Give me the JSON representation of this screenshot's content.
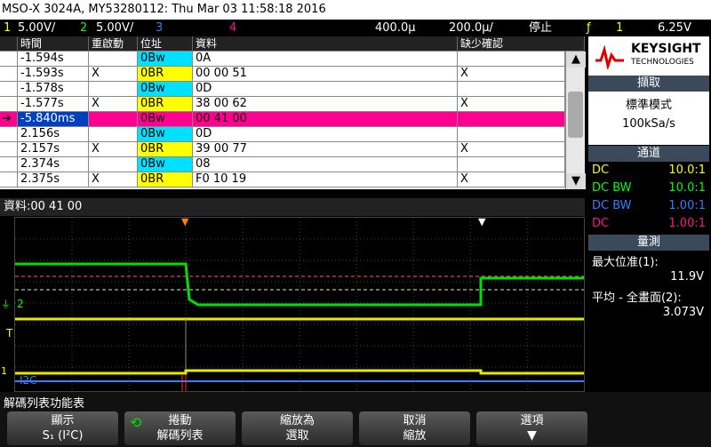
{
  "title": "MSO-X 3024A, MY53280112: Thu Mar 03 11:58:18 2016",
  "status": {
    "ch1_num": "1",
    "ch1_scale": "5.00V/",
    "ch2_num": "2",
    "ch2_scale": "5.00V/",
    "ch3_num": "3",
    "ch4_num": "4",
    "timebase": "400.0µ",
    "delay": "200.0µ/",
    "run_state": "停止",
    "trig_icon": "ƒ",
    "trig_ch": "1",
    "trig_level": "6.25V"
  },
  "table": {
    "headers": [
      "時間",
      "重啟動",
      "位址",
      "資料",
      "缺少確認"
    ],
    "rows": [
      {
        "time": "-1.594s",
        "retry": "",
        "addr": "0Bw",
        "data": "0A",
        "ack": ""
      },
      {
        "time": "-1.593s",
        "retry": "X",
        "addr": "0BR",
        "data": "00 00 51",
        "ack": "X"
      },
      {
        "time": "-1.578s",
        "retry": "",
        "addr": "0Bw",
        "data": "0D",
        "ack": ""
      },
      {
        "time": "-1.577s",
        "retry": "X",
        "addr": "0BR",
        "data": "38 00 62",
        "ack": "X"
      },
      {
        "time": "-5.840ms",
        "retry": "",
        "addr": "0Bw",
        "data": "00 41 00",
        "ack": ""
      },
      {
        "time": "2.156s",
        "retry": "",
        "addr": "0Bw",
        "data": "0D",
        "ack": ""
      },
      {
        "time": "2.157s",
        "retry": "X",
        "addr": "0BR",
        "data": "39 00 77",
        "ack": "X"
      },
      {
        "time": "2.374s",
        "retry": "",
        "addr": "0Bw",
        "data": "08",
        "ack": ""
      },
      {
        "time": "2.375s",
        "retry": "X",
        "addr": "0BR",
        "data": "F0 10 19",
        "ack": "X"
      }
    ],
    "selected_arrow": "➔",
    "scroll_up": "▲",
    "scroll_down": "▼"
  },
  "readout": "資料:00 41 00",
  "scope_labels": {
    "ch2": "2",
    "ch2_ground": "⏚",
    "ch1_marker": "1",
    "trig_marker": "T",
    "i2c_label": "S₁",
    "i2c_suffix": "I2C"
  },
  "side": {
    "brand": "KEYSIGHT",
    "brand_sub": "TECHNOLOGIES",
    "acq_header": "擷取",
    "acq_mode": "標準模式",
    "acq_rate": "100kSa/s",
    "chan_header": "通道",
    "channels": [
      {
        "coupling": "DC",
        "probe": "10.0:1",
        "color": "#ffff00"
      },
      {
        "coupling": "DC BW",
        "probe": "10.0:1",
        "color": "#00ff00"
      },
      {
        "coupling": "DC BW",
        "probe": "1.00:1",
        "color": "#3080ff"
      },
      {
        "coupling": "DC",
        "probe": "1.00:1",
        "color": "#ff1090"
      }
    ],
    "meas_header": "量測",
    "meas1_label": "最大位准(1):",
    "meas1_value": "11.9V",
    "meas2_label": "平均 - 全畫面(2):",
    "meas2_value": "3.073V"
  },
  "softkeys": {
    "title": "解碼列表功能表",
    "k1_line1": "顯示",
    "k1_line2": "S₁ (I²C)",
    "k2_line1": "捲動",
    "k2_line2": "解碼列表",
    "k3_line1": "縮放為",
    "k3_line2": "選取",
    "k4_line1": "取消",
    "k4_line2": "縮放",
    "k5_line1": "選項",
    "k5_icon": "▼"
  },
  "colors": {
    "ch1": "#ffff00",
    "ch2": "#00ff00",
    "ch3": "#3080ff",
    "ch4": "#ff1090",
    "addr_write": "#00e0ff",
    "addr_read": "#ffff00",
    "selected_row": "#ff0090"
  }
}
